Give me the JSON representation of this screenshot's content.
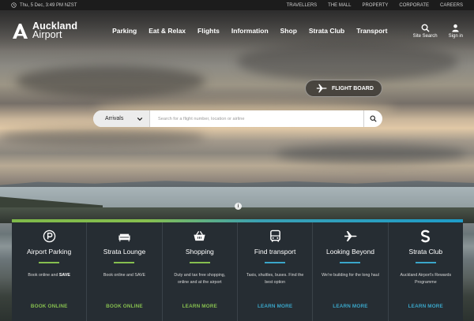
{
  "topbar": {
    "datetime": "Thu, 5 Dec, 3:49 PM NZST",
    "links": [
      "TRAVELLERS",
      "THE MALL",
      "PROPERTY",
      "CORPORATE",
      "CAREERS"
    ]
  },
  "logo": {
    "line1": "Auckland",
    "line2": "Airport"
  },
  "nav": {
    "items": [
      "Parking",
      "Eat & Relax",
      "Flights",
      "Information",
      "Shop",
      "Strata Club",
      "Transport"
    ],
    "site_search": "Site Search",
    "sign_in": "Sign in"
  },
  "flight_board": {
    "label": "FLIGHT BOARD"
  },
  "search": {
    "selected": "Arrivals",
    "placeholder": "Search for a flight number, location or airline"
  },
  "info_icon": "i",
  "colors": {
    "green": "#86bf4f",
    "blue": "#3aa6c9",
    "panel": "#262d33"
  },
  "tiles": [
    {
      "icon": "parking-icon",
      "title": "Airport Parking",
      "desc_a": "Book online and ",
      "desc_b": "SAVE",
      "cta": "BOOK ONLINE",
      "accent": "green"
    },
    {
      "icon": "lounge-icon",
      "title": "Strata Lounge",
      "desc_a": "Book online and SAVE",
      "desc_b": "",
      "cta": "BOOK ONLINE",
      "accent": "green"
    },
    {
      "icon": "shopping-basket-icon",
      "title": "Shopping",
      "desc_a": "Duty and tax free shopping, online and at the airport",
      "desc_b": "",
      "cta": "LEARN MORE",
      "accent": "green"
    },
    {
      "icon": "bus-icon",
      "title": "Find transport",
      "desc_a": "Taxis, shuttles, buses. Find the best option",
      "desc_b": "",
      "cta": "LEARN MORE",
      "accent": "blue"
    },
    {
      "icon": "plane-icon",
      "title": "Looking Beyond",
      "desc_a": "We're building for the long haul",
      "desc_b": "",
      "cta": "LEARN MORE",
      "accent": "blue"
    },
    {
      "icon": "strata-s-icon",
      "title": "Strata Club",
      "desc_a": "Auckland Airport's Rewards Programme",
      "desc_b": "",
      "cta": "LEARN MORE",
      "accent": "blue"
    }
  ]
}
